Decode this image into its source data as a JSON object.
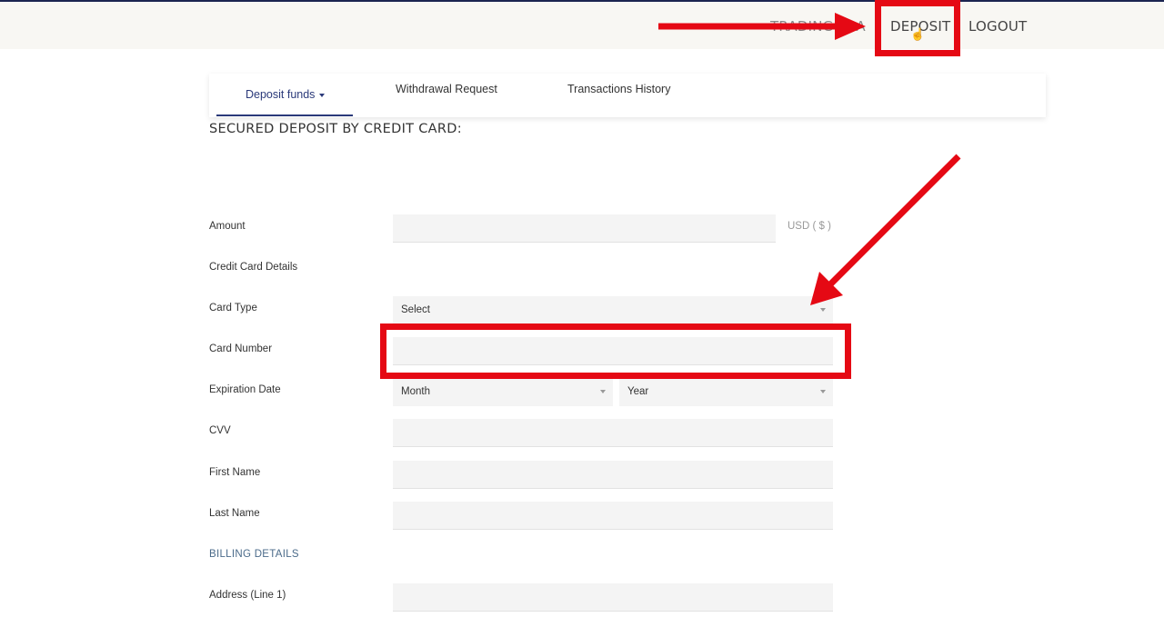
{
  "nav": {
    "trading": "TRADING",
    "trading_suffix": "A",
    "deposit": "DEPOSIT",
    "logout": "LOGOUT"
  },
  "tabs": {
    "deposit_funds": "Deposit funds",
    "withdrawal": "Withdrawal Request",
    "history": "Transactions History"
  },
  "form": {
    "title": "SECURED DEPOSIT BY CREDIT CARD:",
    "amount_label": "Amount",
    "currency": "USD ( $ )",
    "cc_details_label": "Credit Card Details",
    "card_type_label": "Card Type",
    "card_type_value": "Select",
    "card_number_label": "Card Number",
    "expiration_label": "Expiration Date",
    "month_value": "Month",
    "year_value": "Year",
    "cvv_label": "CVV",
    "first_name_label": "First Name",
    "last_name_label": "Last Name",
    "billing_label": "BILLING DETAILS",
    "address1_label": "Address (Line 1)"
  },
  "colors": {
    "annotation": "#e50914",
    "accent": "#2b3a7a",
    "top_border": "#1b2450"
  }
}
